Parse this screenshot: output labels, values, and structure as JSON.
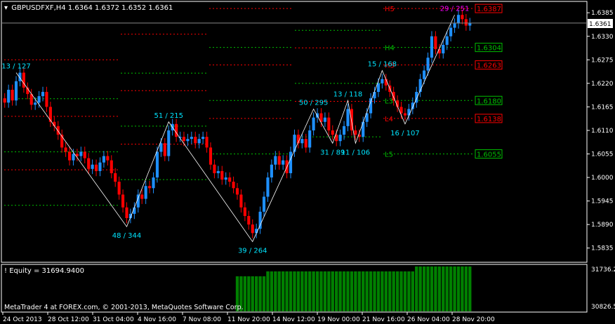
{
  "header": {
    "symbol_title": "GBPUSDFXF,H4  1.6364 1.6372 1.6352 1.6361"
  },
  "indicator": {
    "equity_label": "! Equity = 31694.9400"
  },
  "footer": {
    "copyright": "MetaTrader 4 at FOREX.com, © 2001-2013, MetaQuotes Software Corp."
  },
  "colors": {
    "background": "#000000",
    "bull": "#1E90FF",
    "bear": "#FF0000",
    "axis": "#FFFFFF",
    "pivot_green": "#00C000",
    "pivot_red": "#FF0000",
    "zigzag": "#FFFFFF",
    "swing_label": "#00E5FF",
    "equity_bar": "#008000",
    "magenta": "#FF00FF"
  },
  "chart_data": {
    "type": "candlestick",
    "price_axis": {
      "ylim": [
        1.5805,
        1.6405
      ],
      "ticks": [
        "1.6385",
        "1.6330",
        "1.6275",
        "1.6220",
        "1.6165",
        "1.6110",
        "1.6055",
        "1.6000",
        "1.5945",
        "1.5890",
        "1.5835"
      ],
      "current_price": "1.6361"
    },
    "time_axis_labels": [
      "24 Oct 2013",
      "28 Oct 12:00",
      "31 Oct 04:00",
      "4 Nov 16:00",
      "7 Nov 08:00",
      "11 Nov 20:00",
      "14 Nov 12:00",
      "19 Nov 00:00",
      "21 Nov 16:00",
      "26 Nov 04:00",
      "28 Nov 20:00"
    ],
    "closes": [
      1.6175,
      1.6205,
      1.618,
      1.6225,
      1.6245,
      1.621,
      1.6195,
      1.617,
      1.6175,
      1.619,
      1.62,
      1.6165,
      1.613,
      1.612,
      1.61,
      1.607,
      1.606,
      1.604,
      1.6055,
      1.605,
      1.606,
      1.6045,
      1.602,
      1.603,
      1.6015,
      1.6035,
      1.605,
      1.604,
      1.601,
      1.599,
      1.596,
      1.593,
      1.5905,
      1.5915,
      1.593,
      1.596,
      1.595,
      1.598,
      1.5975,
      1.6,
      1.606,
      1.608,
      1.605,
      1.611,
      1.6125,
      1.6095,
      1.6095,
      1.6085,
      1.609,
      1.6095,
      1.608,
      1.609,
      1.6095,
      1.607,
      1.603,
      1.601,
      1.6015,
      1.5995,
      1.6,
      1.599,
      1.5975,
      1.596,
      1.593,
      1.591,
      1.589,
      1.587,
      1.588,
      1.592,
      1.5955,
      1.6,
      1.603,
      1.605,
      1.603,
      1.604,
      1.601,
      1.606,
      1.61,
      1.608,
      1.609,
      1.607,
      1.611,
      1.614,
      1.615,
      1.613,
      1.614,
      1.611,
      1.61,
      1.6085,
      1.61,
      1.612,
      1.616,
      1.611,
      1.61,
      1.6095,
      1.613,
      1.615,
      1.6185,
      1.62,
      1.622,
      1.623,
      1.6215,
      1.62,
      1.618,
      1.6165,
      1.615,
      1.6145,
      1.616,
      1.6175,
      1.62,
      1.623,
      1.625,
      1.628,
      1.633,
      1.63,
      1.629,
      1.631,
      1.633,
      1.635,
      1.636,
      1.638,
      1.637,
      1.6355,
      1.6361
    ],
    "pivot_levels": [
      {
        "name": "H5",
        "color": "red",
        "label_price": "1.6387"
      },
      {
        "name": "H4",
        "color": "green",
        "label_price": "1.6304"
      },
      {
        "name": "H3",
        "color": "red",
        "label_price": "1.6263"
      },
      {
        "name": "L3",
        "color": "green",
        "label_price": "1.6180"
      },
      {
        "name": "L4",
        "color": "red",
        "label_price": "1.6138"
      },
      {
        "name": "L5",
        "color": "green",
        "label_price": "1.6055"
      }
    ],
    "swing_labels": [
      "13 / 127",
      "48 / 344",
      "51 / 215",
      "39 / 264",
      "50 / 295",
      "31 / 89",
      "13 / 118",
      "11 / 106",
      "15 / 168",
      "16 / 107",
      "29 / 251"
    ],
    "equity_axis": {
      "ticks": [
        "31736.29",
        "30826.55"
      ]
    }
  }
}
